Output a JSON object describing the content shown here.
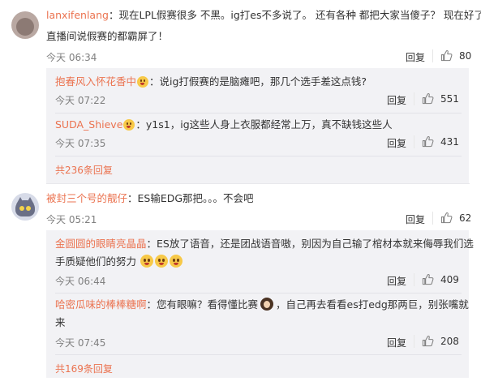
{
  "comments": [
    {
      "user": "lanxifenlang",
      "text_line1": "：现在LPL假赛很多 不黑。ig打es不多说了。 还有各种 都把大家当傻子？ 现在好了",
      "text_line2": "直播间说假赛的都霸屏了！",
      "time": "今天 06:34",
      "reply_label": "回复",
      "likes": "80",
      "replies": [
        {
          "user": "抱春风入怀花香中",
          "text": "：说ig打假赛的是脑瘫吧，那几个选手差这点钱?",
          "time": "今天 07:22",
          "reply_label": "回复",
          "likes": "551"
        },
        {
          "user": "SUDA_Shieve",
          "text": "：y1s1，ig这些人身上衣服都经常上万，真不缺钱这些人",
          "time": "今天 07:35",
          "reply_label": "回复",
          "likes": "431"
        }
      ],
      "more_replies": "共236条回复"
    },
    {
      "user": "被封三个号的靓仔",
      "text_line1": "：ES输EDG那把。。。不会吧",
      "time": "今天 05:21",
      "reply_label": "回复",
      "likes": "62",
      "replies": [
        {
          "user": "金圆圆的眼睛亮晶晶",
          "text_line1": "：ES放了语音，还是团战语音嗷，别因为自己输了棺材本就来侮辱我们选",
          "text_line2": "手质疑他们的努力",
          "time": "今天 06:44",
          "reply_label": "回复",
          "likes": "409"
        },
        {
          "user": "哈密瓜味的棒棒糖啊",
          "text_line1": "：您有眼嘛？看得懂比赛",
          "text_line1b": "，自己再去看看es打edg那两巨，别张嘴就",
          "text_line2": "来",
          "time": "今天 07:45",
          "reply_label": "回复",
          "likes": "208"
        }
      ],
      "more_replies": "共169条回复"
    }
  ],
  "icons": {
    "like": "thumbs-up-icon",
    "emoji": "laughing-emoji-icon",
    "girl": "girl-emoji-icon"
  },
  "colors": {
    "username": "#eb7350",
    "meta": "#808080",
    "reply_bg": "#f2f2f5"
  }
}
